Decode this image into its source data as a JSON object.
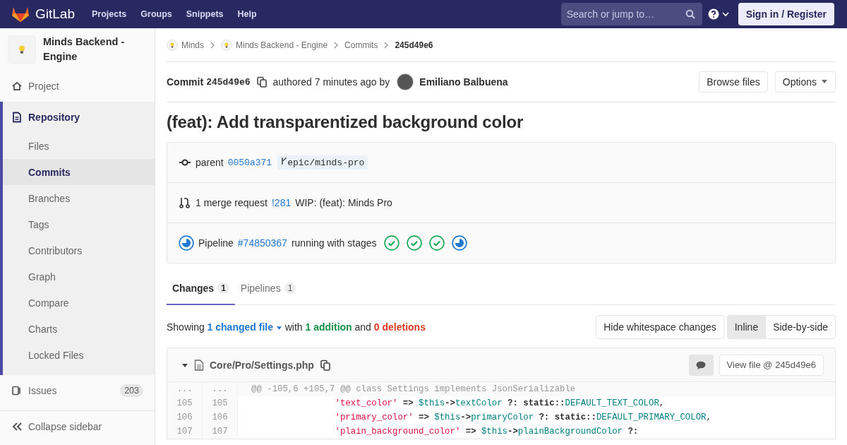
{
  "navbar": {
    "logo": "GitLab",
    "links": [
      "Projects",
      "Groups",
      "Snippets",
      "Help"
    ],
    "search": {
      "placeholder": "Search or jump to…"
    },
    "sign_in": "Sign in / Register"
  },
  "sidebar": {
    "project_name": "Minds Backend - Engine",
    "items": [
      {
        "label": "Project",
        "kind": "home",
        "selected": false
      },
      {
        "label": "Repository",
        "kind": "repo",
        "selected": true,
        "children": [
          {
            "label": "Files",
            "selected": false
          },
          {
            "label": "Commits",
            "selected": true
          },
          {
            "label": "Branches",
            "selected": false
          },
          {
            "label": "Tags",
            "selected": false
          },
          {
            "label": "Contributors",
            "selected": false
          },
          {
            "label": "Graph",
            "selected": false
          },
          {
            "label": "Compare",
            "selected": false
          },
          {
            "label": "Charts",
            "selected": false
          },
          {
            "label": "Locked Files",
            "selected": false
          }
        ]
      },
      {
        "label": "Issues",
        "kind": "issues",
        "selected": false,
        "count": "203"
      }
    ],
    "collapse": "Collapse sidebar"
  },
  "breadcrumbs": [
    {
      "label": "Minds",
      "kind": "group"
    },
    {
      "label": "Minds Backend - Engine",
      "kind": "group"
    },
    {
      "label": "Commits",
      "kind": "link"
    },
    {
      "label": "245d49e6",
      "kind": "current"
    }
  ],
  "commit": {
    "label": "Commit",
    "sha": "245d49e6",
    "authored": "authored 7 minutes ago by",
    "author": "Emiliano Balbuena",
    "browse": "Browse files",
    "options": "Options",
    "title": "(feat): Add transparentized background color"
  },
  "info": {
    "parent_label": "parent",
    "parent_sha": "0050a371",
    "branch": "epic/minds-pro",
    "mr_label": "1 merge request",
    "mr_link": "!281",
    "mr_title": "WIP: (feat): Minds Pro",
    "pipeline_icon": {
      "kind": "running"
    },
    "pipeline_label": "Pipeline",
    "pipeline_link": "#74850367",
    "pipeline_text": "running with stages",
    "stages": [
      {
        "kind": "success"
      },
      {
        "kind": "success"
      },
      {
        "kind": "success"
      },
      {
        "kind": "running"
      }
    ]
  },
  "tabs": [
    {
      "label": "Changes",
      "count": "1",
      "selected": true
    },
    {
      "label": "Pipelines",
      "count": "1",
      "selected": false
    }
  ],
  "summary": {
    "showing": "Showing",
    "files": "1 changed file",
    "with": "with",
    "additions": "1 addition",
    "and": "and",
    "deletions": "0 deletions"
  },
  "diff_controls": {
    "whitespace": "Hide whitespace changes",
    "view_modes": [
      {
        "label": "Inline",
        "selected": true
      },
      {
        "label": "Side-by-side",
        "selected": false
      }
    ]
  },
  "file": {
    "path": "Core/Pro/Settings.php",
    "expanded": true,
    "view_file": "View file @ 245d49e6",
    "lines": [
      {
        "old": "...",
        "new": "...",
        "kind": "match",
        "tokens": [
          {
            "text": "@@ -105,6 +105,7 @@ class Settings implements JsonSerializable",
            "kind": "meta"
          }
        ]
      },
      {
        "old": "105",
        "new": "105",
        "kind": "context",
        "tokens": [
          {
            "text": "                'text_color'",
            "kind": "string"
          },
          {
            "text": " => ",
            "kind": "op"
          },
          {
            "text": "$this",
            "kind": "var"
          },
          {
            "text": "->",
            "kind": "op"
          },
          {
            "text": "textColor",
            "kind": "var"
          },
          {
            "text": " ?: static::",
            "kind": "op"
          },
          {
            "text": "DEFAULT_TEXT_COLOR",
            "kind": "var"
          },
          {
            "text": ",",
            "kind": "plain"
          }
        ]
      },
      {
        "old": "106",
        "new": "106",
        "kind": "context",
        "tokens": [
          {
            "text": "                'primary_color'",
            "kind": "string"
          },
          {
            "text": " => ",
            "kind": "op"
          },
          {
            "text": "$this",
            "kind": "var"
          },
          {
            "text": "->",
            "kind": "op"
          },
          {
            "text": "primaryColor",
            "kind": "var"
          },
          {
            "text": " ?: static::",
            "kind": "op"
          },
          {
            "text": "DEFAULT_PRIMARY_COLOR",
            "kind": "var"
          },
          {
            "text": ",",
            "kind": "plain"
          }
        ]
      },
      {
        "old": "107",
        "new": "107",
        "kind": "context",
        "tokens": [
          {
            "text": "                'plain_background_color'",
            "kind": "string"
          },
          {
            "text": " => ",
            "kind": "op"
          },
          {
            "text": "$this",
            "kind": "var"
          },
          {
            "text": "->",
            "kind": "op"
          },
          {
            "text": "plainBackgroundColor",
            "kind": "var"
          },
          {
            "text": " ?:",
            "kind": "op"
          }
        ]
      }
    ]
  }
}
